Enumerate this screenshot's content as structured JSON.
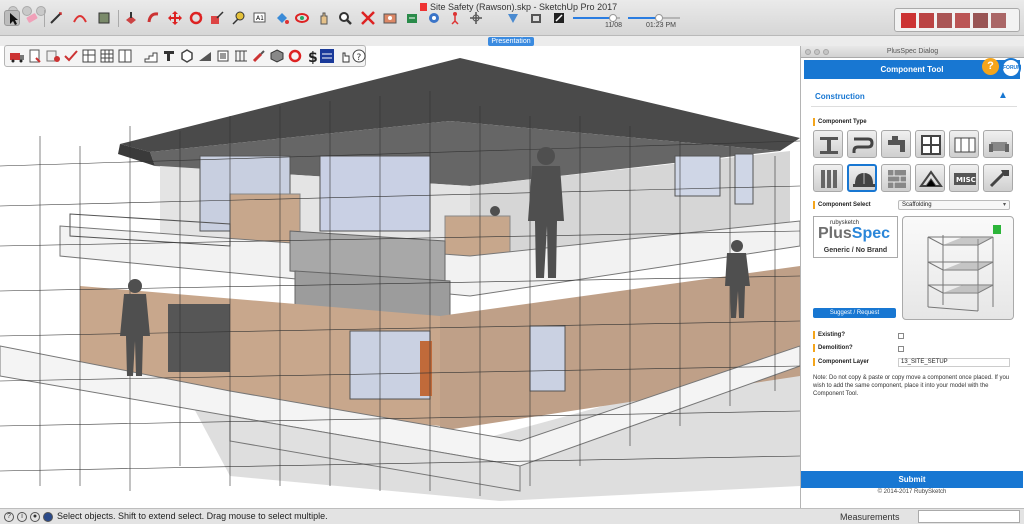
{
  "window": {
    "title": "Site Safety (Rawson).skp - SketchUp Pro 2017"
  },
  "toolbar": {
    "tools": [
      "select-tool",
      "eraser-tool",
      "line-tool",
      "arc-tool",
      "shape-tool",
      "push-pull-tool",
      "follow-me-tool",
      "move-tool",
      "rotate-tool",
      "scale-tool",
      "offset-tool",
      "tape-measure-tool",
      "text-tool",
      "paint-bucket-tool",
      "orbit-tool",
      "pan-tool",
      "zoom-tool",
      "zoom-extents-tool",
      "previous-view-tool",
      "position-camera-tool",
      "look-around-tool",
      "walk-tool",
      "section-plane-tool",
      "style-tool"
    ]
  },
  "scene_controls": {
    "tab_label": "Presentation",
    "time_start": "11/08",
    "time_end": "01:23 PM",
    "date_progress": 0.85,
    "time_progress": 0.6
  },
  "status": {
    "text": "Select objects. Shift to extend select. Drag mouse to select multiple.",
    "measurements_label": "Measurements"
  },
  "dialog": {
    "title": "PlusSpec Dialog",
    "header": "Component Tool",
    "help_glyph": "?",
    "forum_label": "FORUM",
    "section": "Construction",
    "component_type_label": "Component Type",
    "component_types": [
      "steel-beam",
      "plumbing-pipe",
      "tap-fitting",
      "window-frame",
      "cabinet",
      "sofa",
      "cladding",
      "hardhat-scaffolding",
      "brick-wall",
      "roof-truss",
      "misc",
      "tools"
    ],
    "selected_type_index": 7,
    "misc_label": "MISC",
    "component_select_label": "Component Select",
    "component_select_value": "Scaffolding",
    "brand_top": "rubysketch",
    "brand_name_a": "Plus",
    "brand_name_b": "Spec",
    "brand_sub": "Generic / No Brand",
    "suggest_label": "Suggest / Request",
    "existing_label": "Existing?",
    "demolition_label": "Demolition?",
    "layer_label": "Component Layer",
    "layer_value": "13_SITE_SETUP",
    "note": "Note: Do not copy & paste or copy move a component once placed. If you wish to add the same component, place it into your model with the Component Tool.",
    "submit_label": "Submit",
    "copyright": "© 2014-2017 RubySketch"
  },
  "colors": {
    "accent": "#1877d2",
    "help": "#f4a51c",
    "roof": "#5a5a5a",
    "brick": "#c9a88a",
    "render": "#e8e8e8"
  }
}
